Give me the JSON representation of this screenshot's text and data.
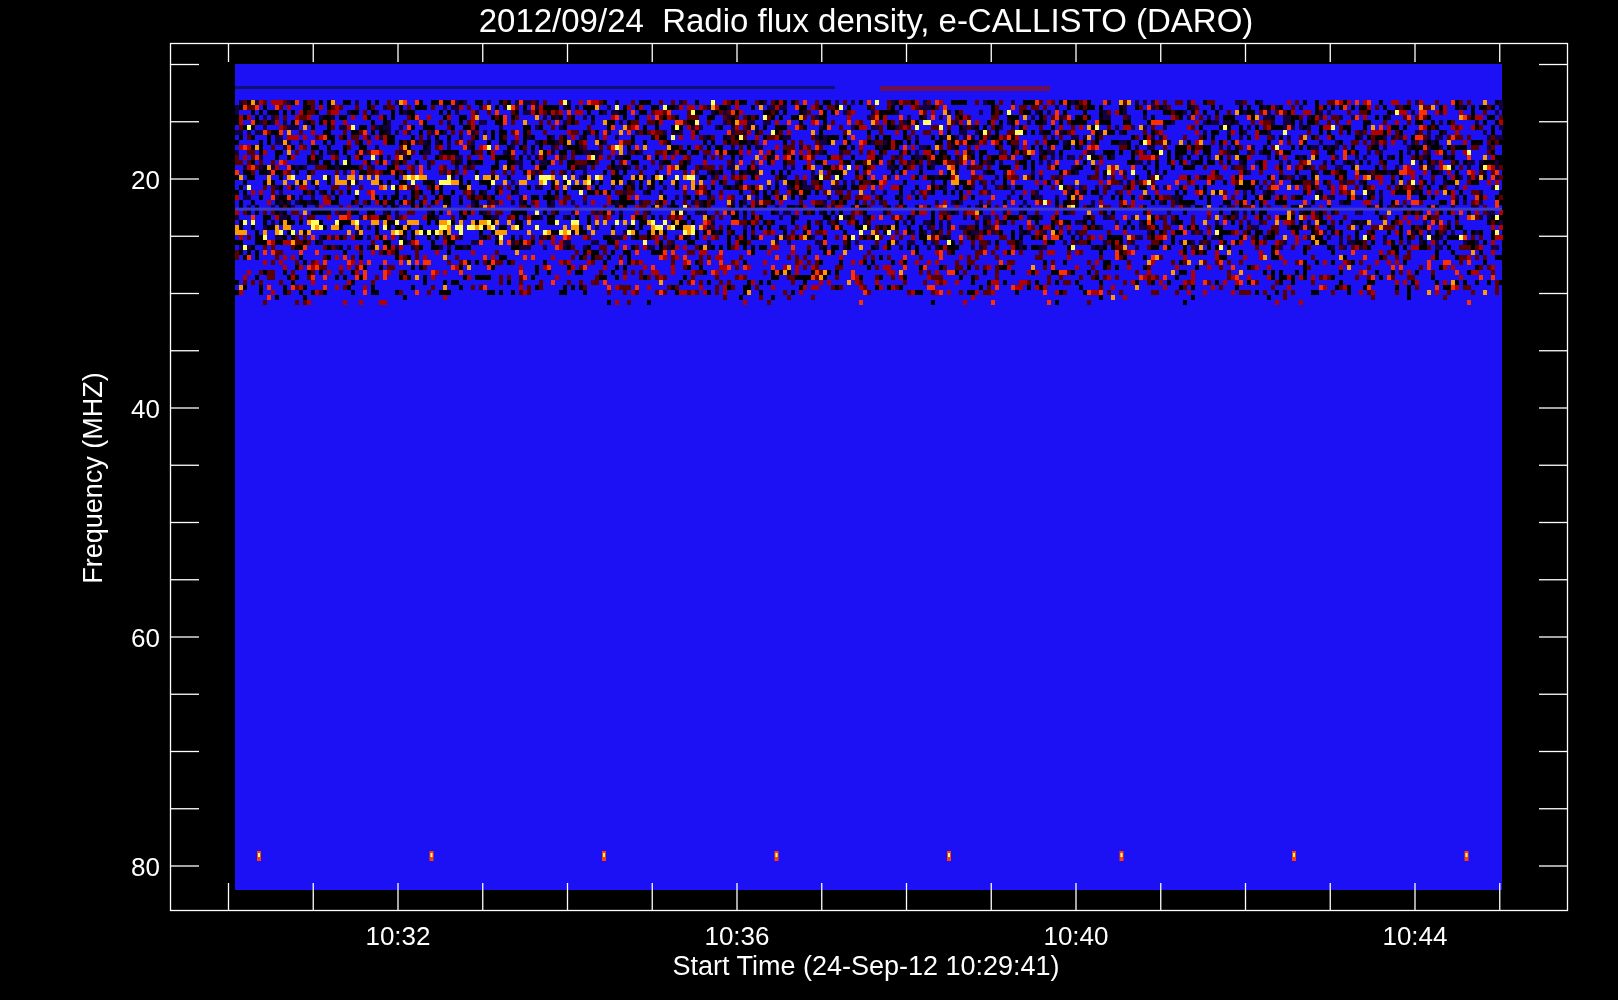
{
  "title": "2012/09/24  Radio flux density, e-CALLISTO (DARO)",
  "y_axis": {
    "label": "Frequency (MHZ)",
    "ticks": [
      "20",
      "40",
      "60",
      "80"
    ]
  },
  "x_axis": {
    "label": "Start Time (24-Sep-12 10:29:41)",
    "ticks": [
      "10:32",
      "10:36",
      "10:40",
      "10:44"
    ]
  }
}
